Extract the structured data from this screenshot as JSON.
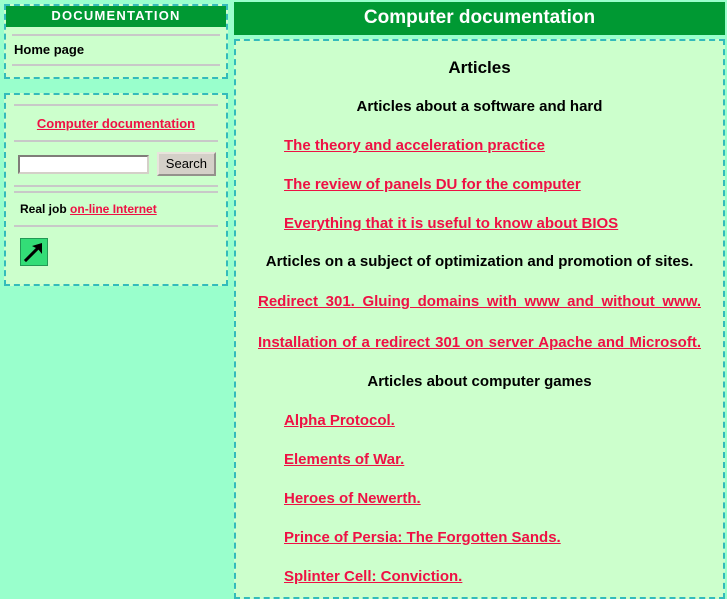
{
  "sidebar": {
    "nav": {
      "header": "DOCUMENTATION",
      "home_label": "Home page"
    },
    "search_panel": {
      "site_link": "Computer documentation",
      "search_value": "",
      "search_placeholder": "",
      "search_button": "Search",
      "realjob_prefix": "Real job",
      "realjob_link": "on-line Internet",
      "arrow_icon": "arrow-up-right-icon"
    }
  },
  "header": {
    "title": "Computer documentation"
  },
  "main": {
    "page_title": "Articles",
    "section_software": "Articles about a software and hard",
    "software_links": [
      "The theory and acceleration practice",
      "The review of panels DU for the computer",
      "Everything that it is useful to know about BIOS"
    ],
    "section_seo": "Articles on a subject of optimization and promotion of sites.",
    "seo_link_line1": "Redirect 301. Gluing domains with www and without www.",
    "seo_link_line2": "Installation of a redirect 301 on server Apache and Microsoft.",
    "section_games": "Articles about computer games",
    "game_links": [
      "Alpha Protocol.",
      "Elements of War.",
      "Heroes of Newerth.",
      "Prince of Persia: The Forgotten Sands.",
      "Splinter Cell: Conviction."
    ]
  },
  "colors": {
    "page_background": "#99ffcc",
    "panel_background": "#ccffcc",
    "header_green": "#009933",
    "link_red": "#ee1144",
    "dashed_border": "#33bbbb"
  }
}
